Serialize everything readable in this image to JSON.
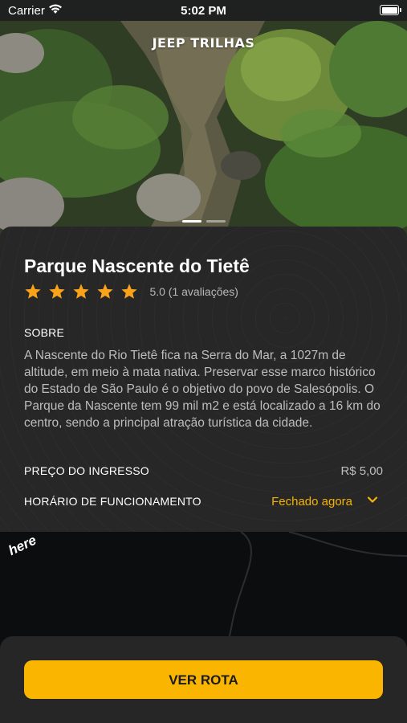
{
  "status_bar": {
    "carrier": "Carrier",
    "time": "5:02 PM"
  },
  "hero": {
    "logo": "JEEP TRILHAS",
    "slides": 2,
    "active_slide": 0
  },
  "place": {
    "title": "Parque Nascente do Tietê",
    "rating_stars": 5,
    "rating_text": "5.0 (1 avaliações)",
    "about_label": "SOBRE",
    "description": "A Nascente do Rio Tietê fica na Serra do Mar, a 1027m de altitude, em meio à mata nativa. Preservar esse marco histórico do Estado de São Paulo é o objetivo do povo de Salesópolis. O Parque da Nascente tem 99 mil m2 e está localizado a 16 km do centro, sendo a principal atração turística da cidade.",
    "price_label": "PREÇO DO INGRESSO",
    "price_value": "R$ 5,00",
    "hours_label": "HORÁRIO DE FUNCIONAMENTO",
    "hours_status": "Fechado agora"
  },
  "map": {
    "provider_logo": "here"
  },
  "action": {
    "route_button": "VER ROTA"
  },
  "colors": {
    "accent": "#F9B500",
    "card": "#272727",
    "background": "#0B0C0D"
  }
}
